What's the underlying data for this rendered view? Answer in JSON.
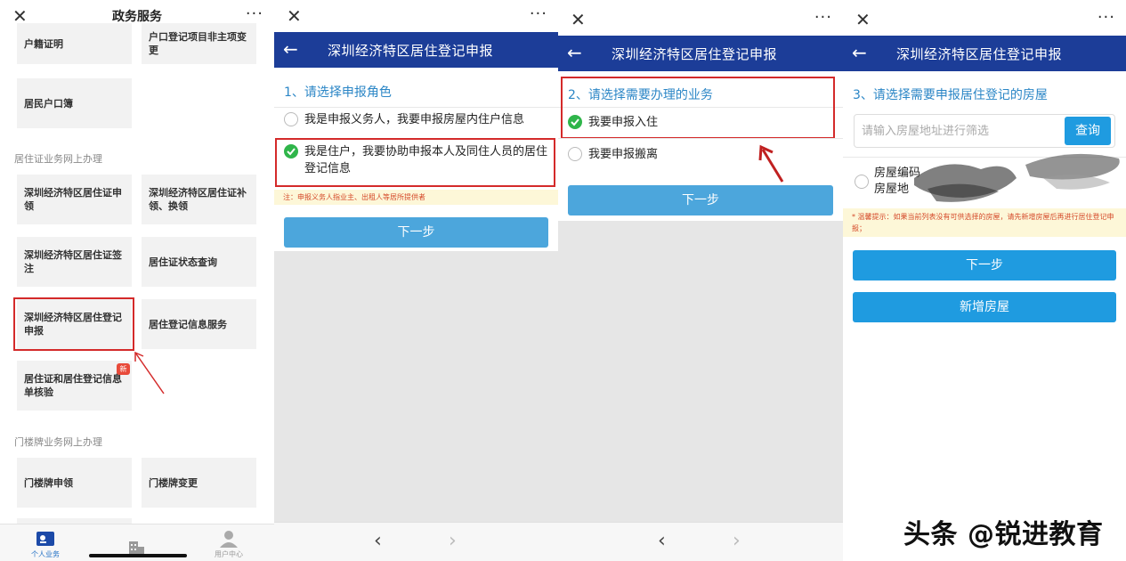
{
  "panel1": {
    "title": "政务服务",
    "close_glyph": "✕",
    "more_glyph": "···",
    "top_tiles": [
      "户籍证明",
      "户口登记项目非主项变更",
      "居民户口簿"
    ],
    "section1": "居住证业务网上办理",
    "tiles1": [
      "深圳经济特区居住证申领",
      "深圳经济特区居住证补领、换领",
      "深圳经济特区居住证签注",
      "居住证状态查询",
      "深圳经济特区居住登记申报",
      "居住登记信息服务",
      "居住证和居住登记信息单核验"
    ],
    "new_badge": "新",
    "section2": "门楼牌业务网上办理",
    "tiles2": [
      "门楼牌申领",
      "门楼牌变更"
    ],
    "tabs": [
      {
        "label": "个人业务",
        "icon": "id-card-icon",
        "active": true
      },
      {
        "label": "用户中心",
        "icon": "user-icon",
        "active": false
      }
    ],
    "accent_color": "#d42a2a"
  },
  "form_title": "深圳经济特区居住登记申报",
  "back_glyph": "←",
  "panel2": {
    "step": "1、请选择申报角色",
    "option1": "我是申报义务人，我要申报房屋内住户信息",
    "option2": "我是住户，我要协助申报本人及同住人员的居住登记信息",
    "note": "注：申报义务人指业主、出租人等居所提供者",
    "next": "下一步"
  },
  "panel3": {
    "step": "2、请选择需要办理的业务",
    "option1": "我要申报入住",
    "option2": "我要申报搬离",
    "next": "下一步"
  },
  "panel4": {
    "step": "3、请选择需要申报居住登记的房屋",
    "search_placeholder": "请输入房屋地址进行筛选",
    "query": "查询",
    "house_code": "房屋编码",
    "house_addr": "房屋地",
    "note": "* 温馨提示：如果当前列表没有可供选择的房屋，请先新增房屋后再进行居住登记申报；",
    "next": "下一步",
    "add_house": "新增房屋"
  },
  "nav": {
    "prev": "‹",
    "next": "›"
  },
  "watermark": "头条 @锐进教育"
}
